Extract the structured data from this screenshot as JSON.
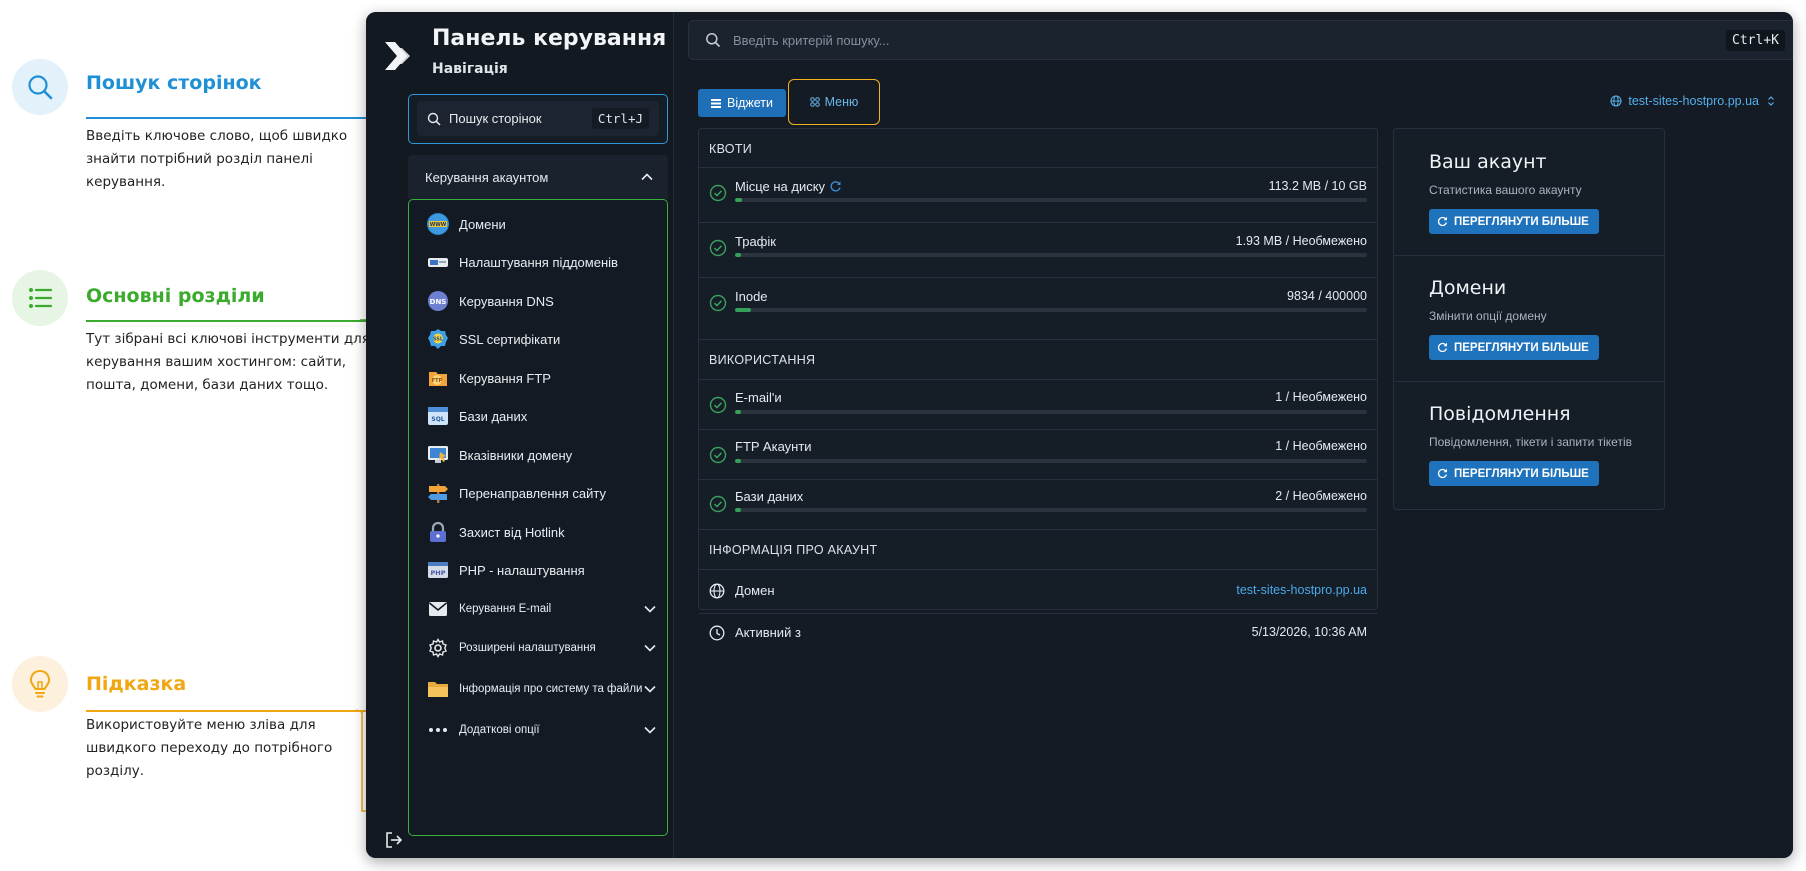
{
  "annotations": {
    "search": {
      "title": "Пошук сторінок",
      "text": "Введіть ключове слово, щоб швидко знайти потрібний розділ панелі керування."
    },
    "sections": {
      "title": "Основні розділи",
      "text": "Тут зібрані всі ключові інструменти для керування вашим хостингом: сайти, пошта, домени, бази даних тощо."
    },
    "tip": {
      "title": "Підказка",
      "text": "Використовуйте меню зліва для швидкого переходу до потрібного розділу."
    }
  },
  "sidebar": {
    "title": "Панель керування",
    "subtitle": "Навігація",
    "search_label": "Пошук сторінок",
    "search_shortcut": "Ctrl+J",
    "account_header": "Керування акаунтом",
    "items": [
      {
        "label": "Домени",
        "icon": "globe-icon"
      },
      {
        "label": "Налаштування піддоменів",
        "icon": "subdomain-icon"
      },
      {
        "label": "Керування DNS",
        "icon": "dns-icon"
      },
      {
        "label": "SSL сертифікати",
        "icon": "ssl-icon"
      },
      {
        "label": "Керування FTP",
        "icon": "ftp-icon"
      },
      {
        "label": "Бази даних",
        "icon": "database-icon"
      },
      {
        "label": "Вказівники домену",
        "icon": "pointer-icon"
      },
      {
        "label": "Перенаправлення сайту",
        "icon": "redirect-icon"
      },
      {
        "label": "Захист від Hotlink",
        "icon": "lock-icon"
      },
      {
        "label": "PHP - налаштування",
        "icon": "php-icon"
      }
    ],
    "groups": [
      {
        "label": "Керування E-mail",
        "icon": "mail-icon"
      },
      {
        "label": "Розширені налаштування",
        "icon": "gear-icon"
      },
      {
        "label": "Інформація про систему та файли",
        "icon": "folder-icon"
      },
      {
        "label": "Додаткові опції",
        "icon": "dots-icon"
      }
    ]
  },
  "topbar": {
    "search_placeholder": "Введіть критерій пошуку...",
    "search_shortcut": "Ctrl+K"
  },
  "toolbar": {
    "widgets_label": "Віджети",
    "menu_label": "Меню",
    "domain": "test-sites-hostpro.pp.ua"
  },
  "quotas": {
    "title": "КВОТИ",
    "rows": [
      {
        "label": "Місце на диску",
        "value": "113.2 MB / 10 GB",
        "fill": 0.011
      },
      {
        "label": "Трафік",
        "value": "1.93 MB / Необмежено",
        "fill": 0.01
      },
      {
        "label": "Inode",
        "value": "9834 / 400000",
        "fill": 0.025
      }
    ]
  },
  "usage": {
    "title": "ВИКОРИСТАННЯ",
    "rows": [
      {
        "label": "E-mail'и",
        "value": "1 / Необмежено",
        "fill": 0.01
      },
      {
        "label": "FTP Акаунти",
        "value": "1 / Необмежено",
        "fill": 0.01
      },
      {
        "label": "Бази даних",
        "value": "2 / Необмежено",
        "fill": 0.01
      }
    ]
  },
  "account_info": {
    "title": "ІНФОРМАЦІЯ ПРО АКАУНТ",
    "domain_label": "Домен",
    "domain_value": "test-sites-hostpro.pp.ua",
    "active_label": "Активний з",
    "active_value": "5/13/2026, 10:36 AM"
  },
  "cards": [
    {
      "title": "Ваш акаунт",
      "subtitle": "Статистика вашого акаунту",
      "button": "ПЕРЕГЛЯНУТИ БІЛЬШЕ"
    },
    {
      "title": "Домени",
      "subtitle": "Змінити опції домену",
      "button": "ПЕРЕГЛЯНУТИ БІЛЬШЕ"
    },
    {
      "title": "Повідомлення",
      "subtitle": "Повідомлення, тікети і запити тікетів",
      "button": "ПЕРЕГЛЯНУТИ БІЛЬШЕ"
    }
  ],
  "colors": {
    "accent_blue": "#1f8fd6",
    "accent_green": "#3aab2c",
    "accent_yellow": "#f0a713",
    "panel_bg": "#141b24"
  }
}
